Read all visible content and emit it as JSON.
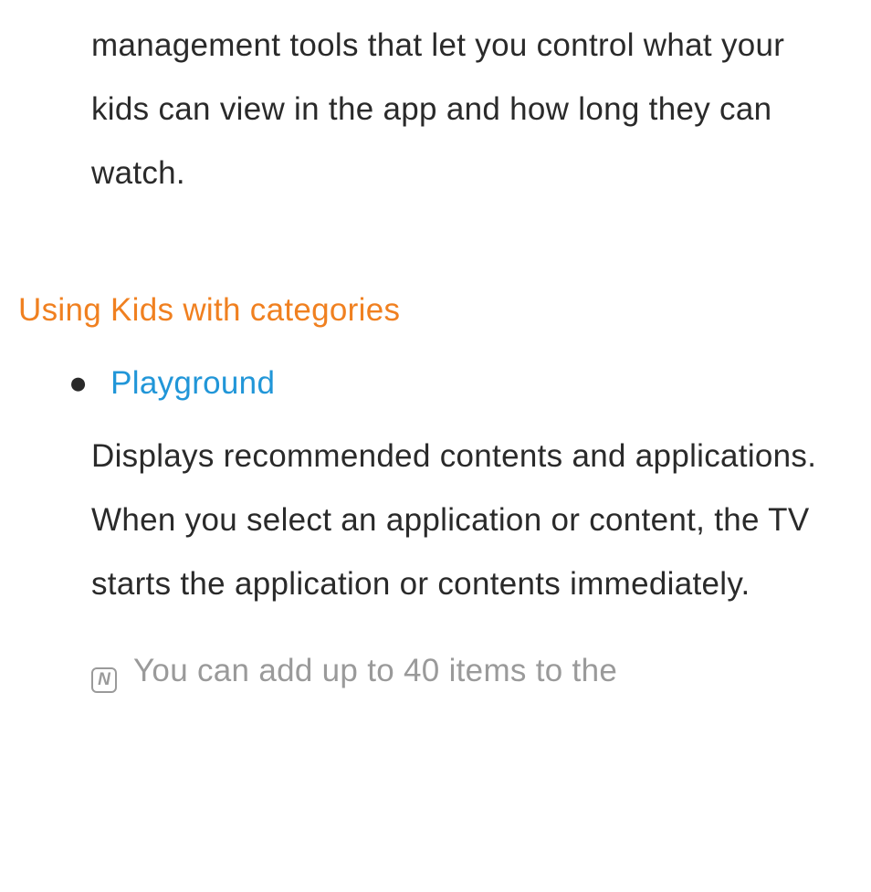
{
  "intro": "management tools that let you control what your kids can view in the app and how long they can watch.",
  "section": {
    "heading": "Using Kids with categories",
    "items": [
      {
        "title": "Playground",
        "description": "Displays recommended contents and applications. When you select an application or content, the TV starts the application or contents immediately.",
        "note_icon": "N",
        "note": "You can add up to 40 items to the"
      }
    ]
  }
}
